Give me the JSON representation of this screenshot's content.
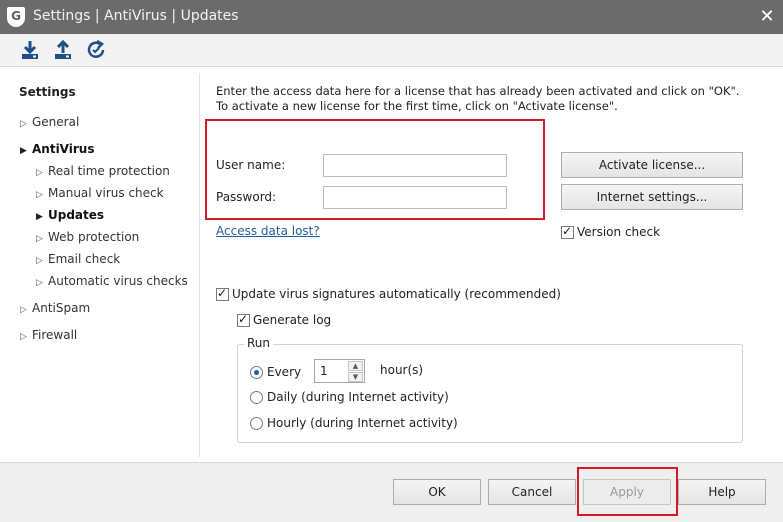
{
  "window": {
    "title": "Settings | AntiVirus | Updates",
    "logo_letter": "G"
  },
  "toolbar": {
    "buttons": [
      "download-icon",
      "upload-icon",
      "reset-icon"
    ]
  },
  "sidebar": {
    "heading": "Settings",
    "items": [
      {
        "label": "General"
      },
      {
        "label": "AntiVirus"
      },
      {
        "label": "Real time protection"
      },
      {
        "label": "Manual virus check"
      },
      {
        "label": "Updates"
      },
      {
        "label": "Web protection"
      },
      {
        "label": "Email check"
      },
      {
        "label": "Automatic virus checks"
      },
      {
        "label": "AntiSpam"
      },
      {
        "label": "Firewall"
      }
    ]
  },
  "main": {
    "intro_line1": "Enter the access data here for a license that has already been activated and click on \"OK\".",
    "intro_line2": "To activate a new license for the first time, click on \"Activate license\".",
    "username_label": "User name:",
    "username_value": "",
    "password_label": "Password:",
    "password_value": "",
    "access_link": "Access data lost?",
    "activate_button": "Activate license...",
    "internet_button": "Internet settings...",
    "version_check": {
      "label": "Version check",
      "checked": true
    },
    "auto_update": {
      "label": "Update virus signatures automatically (recommended)",
      "checked": true
    },
    "generate_log": {
      "label": "Generate log",
      "checked": true
    },
    "run": {
      "title": "Run",
      "every_label": "Every",
      "every_value": "1",
      "hours_label": "hour(s)",
      "daily_label": "Daily (during Internet activity)",
      "hourly_label": "Hourly (during Internet activity)",
      "selected": "every"
    }
  },
  "footer": {
    "ok": "OK",
    "cancel": "Cancel",
    "apply": "Apply",
    "help": "Help"
  },
  "colors": {
    "titlebar": "#6b6b6b",
    "highlight": "#d11a2a",
    "link": "#1f5f9c"
  }
}
